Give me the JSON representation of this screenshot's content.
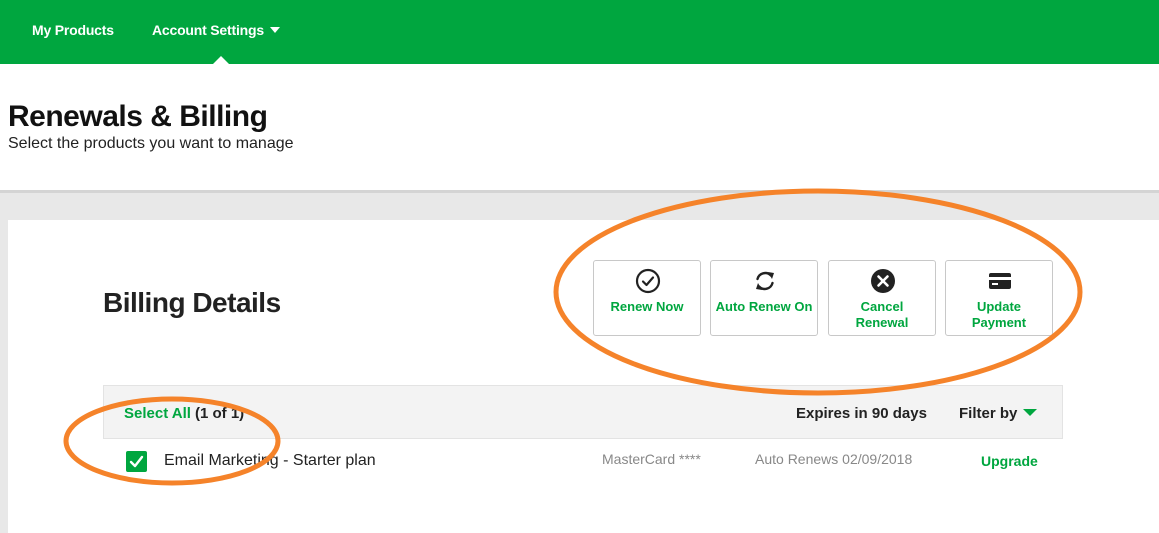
{
  "nav": {
    "my_products": "My Products",
    "account_settings": "Account Settings"
  },
  "header": {
    "title": "Renewals & Billing",
    "subtitle": "Select the products you want to manage"
  },
  "billing": {
    "title": "Billing Details",
    "actions": [
      {
        "label": "Renew Now",
        "icon": "check-circle-icon"
      },
      {
        "label": "Auto Renew On",
        "icon": "refresh-icon"
      },
      {
        "label": "Cancel Renewal",
        "icon": "x-circle-icon"
      },
      {
        "label": "Update Payment",
        "icon": "credit-card-icon"
      }
    ]
  },
  "table": {
    "select_all": "Select All",
    "selected_count": "(1 of 1)",
    "expires_filter": "Expires in 90 days",
    "filter_by": "Filter by",
    "rows": [
      {
        "checked": true,
        "product": "Email Marketing - Starter plan",
        "payment": "MasterCard ****",
        "renewal": "Auto Renews 02/09/2018",
        "action": "Upgrade"
      }
    ]
  },
  "colors": {
    "brand_green": "#00a63f",
    "annotation_orange": "#f5832a"
  }
}
